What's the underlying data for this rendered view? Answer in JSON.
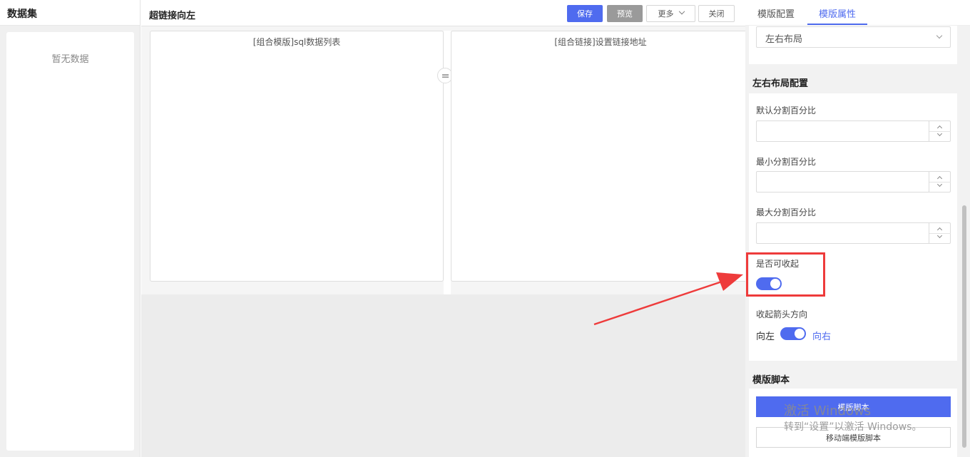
{
  "left_panel": {
    "title": "数据集",
    "empty_text": "暂无数据"
  },
  "editor": {
    "title": "超链接向左",
    "buttons": {
      "save": "保存",
      "preview": "预览",
      "more": "更多",
      "close": "关闭"
    },
    "left_pane_title": "[组合模版]sql数据列表",
    "right_pane_title": "[组合链接]设置链接地址"
  },
  "props_panel": {
    "tabs": [
      {
        "label": "模版配置"
      },
      {
        "label": "模版属性"
      }
    ],
    "active_tab": "模版属性",
    "layout_select_value": "左右布局",
    "layout_section_title": "左右布局配置",
    "fields": {
      "default_split": {
        "label": "默认分割百分比",
        "value": ""
      },
      "min_split": {
        "label": "最小分割百分比",
        "value": ""
      },
      "max_split": {
        "label": "最大分割百分比",
        "value": ""
      }
    },
    "collapsible": {
      "label": "是否可收起",
      "on": true
    },
    "arrow_direction": {
      "label": "收起箭头方向",
      "left_label": "向左",
      "right_label": "向右",
      "selected": "向右"
    },
    "script_section_title": "模版脚本",
    "script_button": "模版脚本",
    "mobile_script_button": "移动端模版脚本"
  },
  "watermark": {
    "line1": "激活 Windows",
    "line2": "转到“设置”以激活 Windows。"
  },
  "colors": {
    "accent": "#4f6bef",
    "highlight": "#ee3b3b",
    "preview_button": "#9a9a9a"
  }
}
